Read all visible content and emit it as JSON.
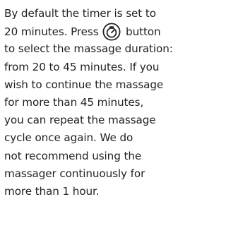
{
  "instructions": {
    "line1": "By default the timer is set to",
    "line2_before_icon": "20 minutes. Press",
    "line2_after_icon": "button",
    "line3": "to select the massage duration:",
    "line4": "from 20 to 45 minutes. If you",
    "line5": "wish to continue the massage",
    "line6": "for more than 45 minutes,",
    "line7": "you can repeat the massage",
    "line8": "cycle once again. We do",
    "line9": "not recommend using the",
    "line10": "massager continuously for",
    "line11": "more than 1 hour.",
    "icon": "timer-icon"
  }
}
